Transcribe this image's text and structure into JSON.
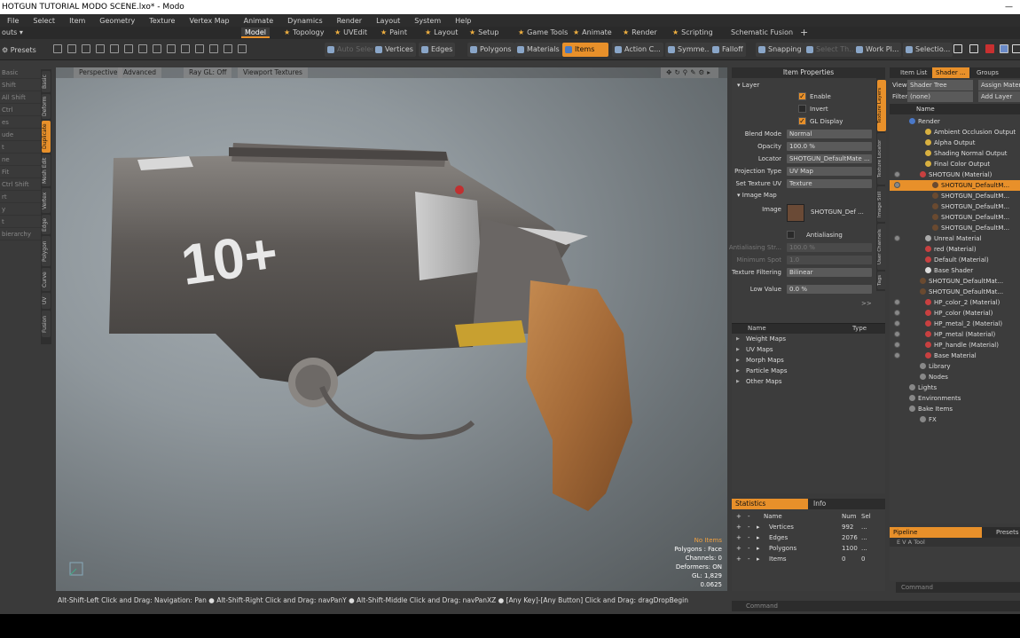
{
  "window": {
    "title": "HOTGUN TUTORIAL MODO SCENE.lxo* - Modo"
  },
  "menu": [
    "File",
    "Select",
    "Item",
    "Geometry",
    "Texture",
    "Vertex Map",
    "Animate",
    "Dynamics",
    "Render",
    "Layout",
    "System",
    "Help"
  ],
  "layout_label": "outs",
  "tabs": [
    "Model",
    "Topology",
    "UVEdit",
    "Paint",
    "Layout",
    "Setup",
    "Game Tools",
    "Animate",
    "Render",
    "Scripting",
    "Schematic Fusion"
  ],
  "toolbar": {
    "presets": "Presets",
    "buttons": [
      "Auto Select",
      "Vertices",
      "Edges",
      "Polygons",
      "Materials",
      "Items",
      "Action C...",
      "Symme...",
      "Falloff",
      "Snapping",
      "Select Th...",
      "Work Pl...",
      "Selectio..."
    ]
  },
  "left_tools": [
    "Basic",
    "Shift",
    "All Shift",
    "Ctrl",
    "es",
    "ude",
    "t",
    "ne",
    "Fit",
    "Ctrl Shift",
    "rt",
    "y",
    "t",
    "bierarchy"
  ],
  "vertical_tabs": [
    "Basic",
    "Deform",
    "Duplicate",
    "Mesh Edit",
    "Vertex",
    "Edge",
    "Polygon",
    "Curve",
    "UV",
    "Fusion"
  ],
  "viewport": {
    "header": [
      "Perspective",
      "Advanced",
      "Ray GL: Off",
      "Viewport Textures"
    ],
    "stats": {
      "no_items": "No Items",
      "polygons": "Polygons : Face",
      "channels": "Channels: 0",
      "deformers": "Deformers: ON",
      "gl": "GL: 1,829",
      "scale": "0.0625"
    },
    "decal_text": "10+"
  },
  "status_bar": "Alt-Shift-Left Click and Drag: Navigation: Pan ●  Alt-Shift-Right Click and Drag: navPanY ●  Alt-Shift-Middle Click and Drag: navPanXZ ●  [Any Key]-[Any Button] Click and Drag: dragDropBegin",
  "item_properties": {
    "title": "Item Properties",
    "layer": "Layer",
    "enable": "Enable",
    "invert": "Invert",
    "gl_display": "GL Display",
    "blend_mode_label": "Blend Mode",
    "blend_mode": "Normal",
    "opacity_label": "Opacity",
    "opacity": "100.0 %",
    "locator_label": "Locator",
    "locator": "SHOTGUN_DefaultMate ...",
    "projection_label": "Projection Type",
    "projection": "UV Map",
    "texture_uv_label": "Set Texture UV",
    "texture_uv": "Texture",
    "image_map": "Image Map",
    "image_label": "Image",
    "image": "SHOTGUN_Def ...",
    "antialiasing": "Antialiasing",
    "aa_strength_label": "Antialiasing Str...",
    "aa_strength": "100.0 %",
    "min_spot_label": "Minimum Spot",
    "min_spot": "1.0",
    "filtering_label": "Texture Filtering",
    "filtering": "Bilinear",
    "low_value_label": "Low Value",
    "low_value": "0.0 %",
    "more": ">>",
    "side_tabs": [
      "Texture Layers",
      "Texture Locator",
      "Image Still",
      "User Channels",
      "Tags"
    ]
  },
  "maps_panel": {
    "col_name": "Name",
    "col_type": "Type",
    "items": [
      "Weight Maps",
      "UV Maps",
      "Morph Maps",
      "Particle Maps",
      "Other Maps"
    ]
  },
  "statistics": {
    "tab_active": "Statistics",
    "tab_info": "Info",
    "headers": [
      "Name",
      "Num",
      "Sel"
    ],
    "rows": [
      {
        "name": "Vertices",
        "num": "992",
        "sel": "..."
      },
      {
        "name": "Edges",
        "num": "2076",
        "sel": "..."
      },
      {
        "name": "Polygons",
        "num": "1100",
        "sel": "..."
      },
      {
        "name": "Items",
        "num": "0",
        "sel": "0"
      }
    ]
  },
  "shader": {
    "tabs": [
      "Item List",
      "Shader ...",
      "Groups"
    ],
    "view_label": "View",
    "view_value": "Shader Tree",
    "assign": "Assign Materia",
    "filter_label": "Filter",
    "filter_value": "(none)",
    "add_layer": "Add Layer",
    "col_name": "Name",
    "rows": [
      {
        "name": "Render",
        "color": "#4a78c8"
      },
      {
        "name": "Ambient Occlusion Output",
        "color": "#d8b040"
      },
      {
        "name": "Alpha Output",
        "color": "#d8b040"
      },
      {
        "name": "Shading Normal Output",
        "color": "#d8b040"
      },
      {
        "name": "Final Color Output",
        "color": "#d8b040"
      },
      {
        "name": "SHOTGUN (Material)",
        "color": "#c84040"
      },
      {
        "name": "SHOTGUN_DefaultM...",
        "color": "#6a4a30"
      },
      {
        "name": "SHOTGUN_DefaultM...",
        "color": "#6a4a30"
      },
      {
        "name": "SHOTGUN_DefaultM...",
        "color": "#6a4a30"
      },
      {
        "name": "SHOTGUN_DefaultM...",
        "color": "#6a4a30"
      },
      {
        "name": "SHOTGUN_DefaultM...",
        "color": "#6a4a30"
      },
      {
        "name": "Unreal Material",
        "color": "#aaaaaa"
      },
      {
        "name": "red (Material)",
        "color": "#c84040"
      },
      {
        "name": "Default (Material)",
        "color": "#c84040"
      },
      {
        "name": "Base Shader",
        "color": "#dddddd"
      },
      {
        "name": "SHOTGUN_DefaultMat...",
        "color": "#6a4a30"
      },
      {
        "name": "SHOTGUN_DefaultMat...",
        "color": "#6a4a30"
      },
      {
        "name": "HP_color_2 (Material)",
        "color": "#c84040"
      },
      {
        "name": "HP_color (Material)",
        "color": "#c84040"
      },
      {
        "name": "HP_metal_2 (Material)",
        "color": "#c84040"
      },
      {
        "name": "HP_metal (Material)",
        "color": "#c84040"
      },
      {
        "name": "HP_handle (Material)",
        "color": "#c84040"
      },
      {
        "name": "Base Material",
        "color": "#c84040"
      },
      {
        "name": "Library",
        "color": "#888888"
      },
      {
        "name": "Nodes",
        "color": "#888888"
      },
      {
        "name": "Lights",
        "color": "#888888"
      },
      {
        "name": "Environments",
        "color": "#888888"
      },
      {
        "name": "Bake Items",
        "color": "#888888"
      },
      {
        "name": "FX",
        "color": "#888888"
      }
    ]
  },
  "pipeline": {
    "tab": "Pipeline",
    "presets": "Presets",
    "cols": "E V A Tool",
    "command_placeholder": "Command"
  },
  "command_bar": "Command",
  "colors": {
    "accent": "#e8902a"
  }
}
